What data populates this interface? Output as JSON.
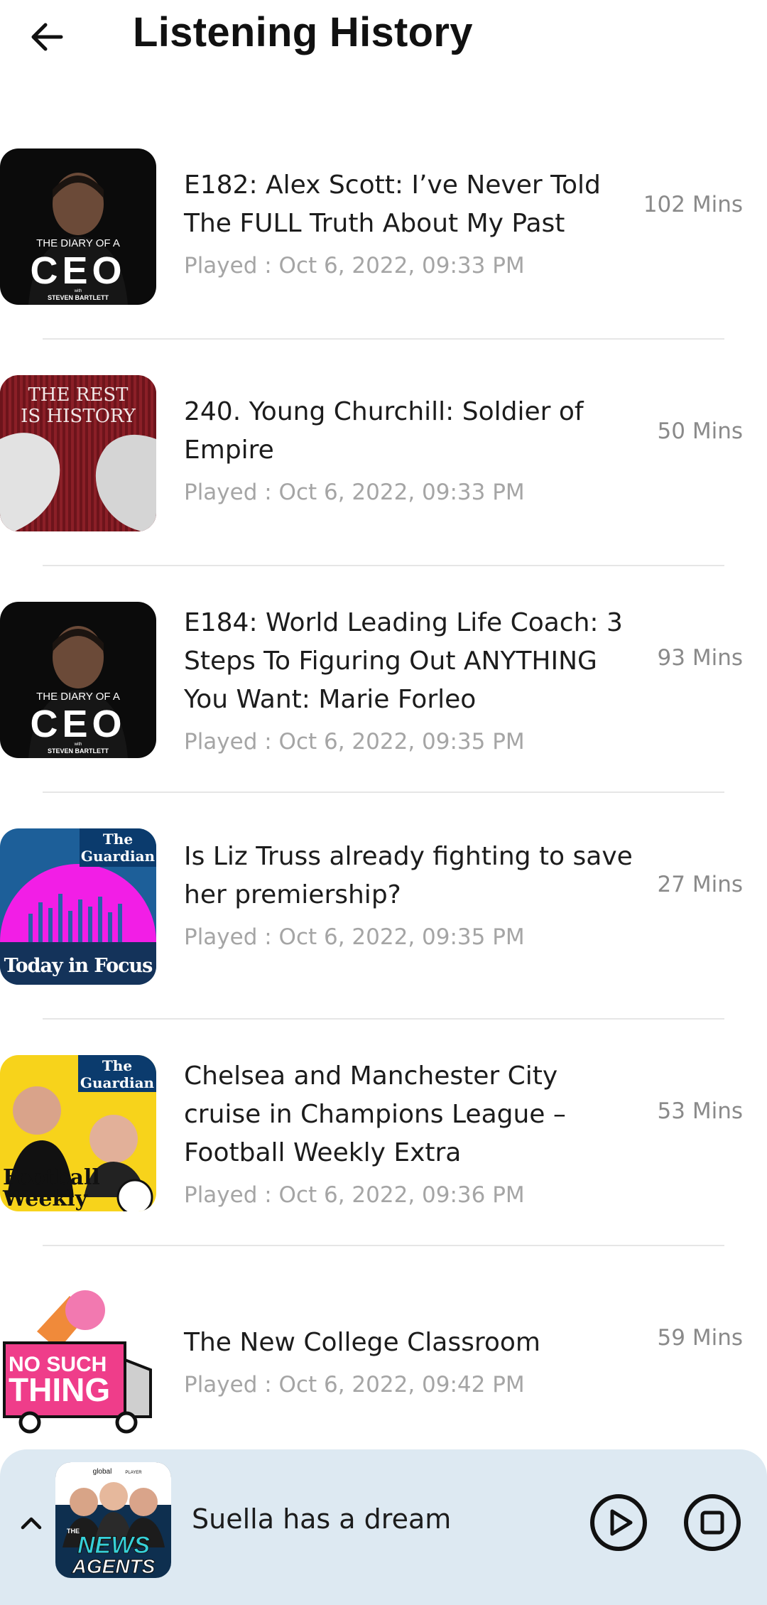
{
  "header": {
    "title": "Listening History",
    "back_icon": "arrow-left-icon"
  },
  "history": [
    {
      "title": "E182: Alex Scott: I’ve Never Told The FULL Truth About My Past",
      "played": "Played : Oct 6, 2022, 09:33 PM",
      "duration": "102 Mins",
      "art": "diary-of-a-ceo"
    },
    {
      "title": "240. Young Churchill: Soldier of Empire",
      "played": "Played : Oct 6, 2022, 09:33 PM",
      "duration": "50 Mins",
      "art": "the-rest-is-history"
    },
    {
      "title": "E184: World Leading Life Coach: 3 Steps To Figuring Out ANYTHING You Want: Marie Forleo",
      "played": "Played : Oct 6, 2022, 09:35 PM",
      "duration": "93 Mins",
      "art": "diary-of-a-ceo"
    },
    {
      "title": "Is Liz Truss already fighting to save her premiership?",
      "played": "Played : Oct 6, 2022, 09:35 PM",
      "duration": "27 Mins",
      "art": "today-in-focus"
    },
    {
      "title": "Chelsea and Manchester City cruise in Champions League – Football Weekly Extra",
      "played": "Played : Oct 6, 2022, 09:36 PM",
      "duration": "53 Mins",
      "art": "football-weekly"
    },
    {
      "title": "The New College Classroom",
      "played": "Played : Oct 6, 2022, 09:42 PM",
      "duration": "59 Mins",
      "art": "no-such-thing"
    }
  ],
  "art_text": {
    "ceo_small": "THE DIARY OF A",
    "ceo_big": "CEO",
    "ceo_with": "with",
    "ceo_host": "STEVEN BARTLETT",
    "rest_line1": "THE REST",
    "rest_line2": "IS HISTORY",
    "guardian_the": "The",
    "guardian_name": "Guardian",
    "today_focus": "Today in Focus",
    "football_line1": "Football",
    "football_line2": "Weekly",
    "nst_line1": "NO SUCH",
    "nst_line2": "THING",
    "global_brand": "global",
    "global_suffix": "PLAYER",
    "news_the": "THE",
    "news_line1": "NEWS",
    "news_line2": "AGENTS"
  },
  "player": {
    "now_playing": "Suella has a dream",
    "expand_icon": "chevron-up-icon",
    "play_icon": "play-circle-icon",
    "stop_icon": "stop-circle-icon"
  },
  "colors": {
    "background": "#ffffff",
    "player_bg": "#dde9f2",
    "muted_text": "#a5a5a5",
    "divider": "#e6e6e6"
  }
}
